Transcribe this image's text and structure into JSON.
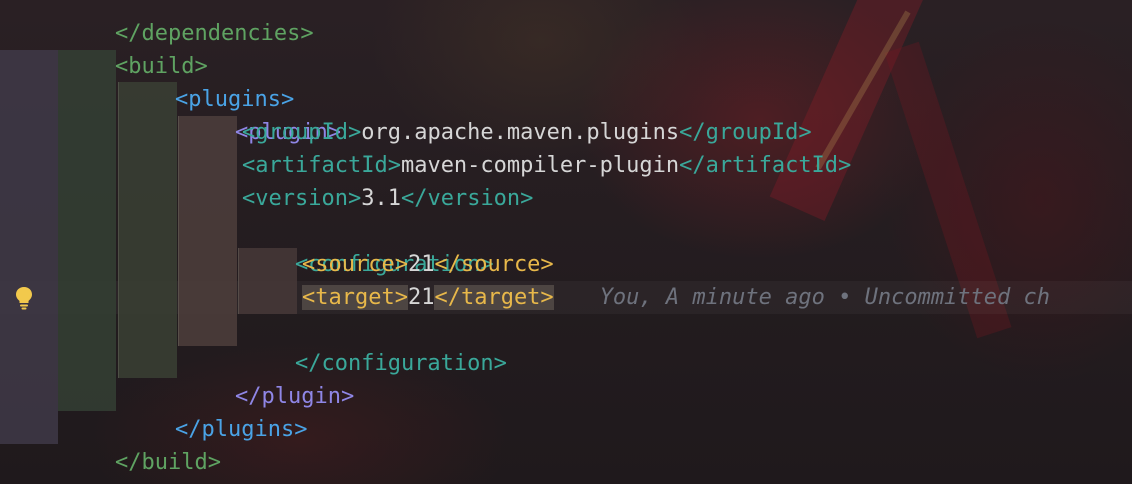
{
  "code": {
    "line_0": "</dependencies>",
    "line_1": "<build>",
    "line_2": "<plugins>",
    "line_3": "<plugin>",
    "groupId_open": "<groupId>",
    "groupId_value": "org.apache.maven.plugins",
    "groupId_close": "</groupId>",
    "artifactId_open": "<artifactId>",
    "artifactId_value": "maven-compiler-plugin",
    "artifactId_close": "</artifactId>",
    "version_open": "<version>",
    "version_value": "3.1",
    "version_close": "</version>",
    "configuration_open": "<configuration>",
    "source_open": "<source>",
    "source_value": "21",
    "source_close": "</source>",
    "target_open": "<target>",
    "target_value": "21",
    "target_close": "</target>",
    "configuration_close": "</configuration>",
    "plugin_close": "</plugin>",
    "plugins_close": "</plugins>",
    "build_close": "</build>"
  },
  "blame": {
    "text": "You, A minute ago • Uncommitted ch"
  },
  "gutter": {
    "icon": "lightbulb-icon",
    "icon_color": "#f2c94c"
  },
  "colors": {
    "tag_level1": "#5fa362",
    "tag_level2": "#4aa3e6",
    "tag_level3": "#8f86e6",
    "tag_level4": "#3aa89a",
    "tag_level5": "#e8b84a",
    "text": "#d6d6d6"
  }
}
